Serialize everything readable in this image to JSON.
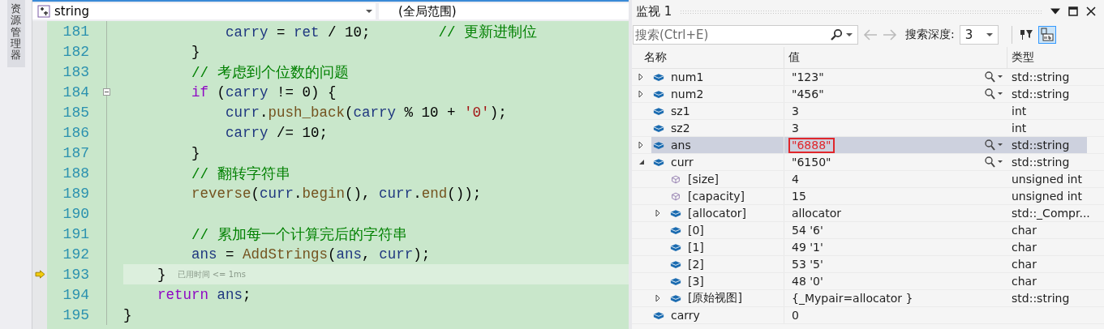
{
  "side_tab": {
    "label": "资源管理器"
  },
  "editor": {
    "scope_combo": {
      "value": "string"
    },
    "member_combo": {
      "value": "(全局范围)"
    },
    "lines": [
      {
        "number": "181",
        "current": false,
        "fold": false,
        "tokens": [
          {
            "kind": "var",
            "text": "            carry"
          },
          {
            "kind": "plain",
            "text": " = "
          },
          {
            "kind": "var",
            "text": "ret"
          },
          {
            "kind": "plain",
            "text": " / 10;        "
          },
          {
            "kind": "comment",
            "text": "// 更新进制位"
          }
        ]
      },
      {
        "number": "182",
        "current": false,
        "fold": false,
        "tokens": [
          {
            "kind": "plain",
            "text": "        }"
          }
        ]
      },
      {
        "number": "183",
        "current": false,
        "fold": false,
        "tokens": [
          {
            "kind": "comment",
            "text": "        // 考虑到个位数的问题"
          }
        ]
      },
      {
        "number": "184",
        "current": false,
        "fold": true,
        "tokens": [
          {
            "kind": "keyword",
            "text": "        if"
          },
          {
            "kind": "plain",
            "text": " ("
          },
          {
            "kind": "var",
            "text": "carry"
          },
          {
            "kind": "plain",
            "text": " != 0) {"
          }
        ]
      },
      {
        "number": "185",
        "current": false,
        "fold": false,
        "tokens": [
          {
            "kind": "var",
            "text": "            curr"
          },
          {
            "kind": "plain",
            "text": "."
          },
          {
            "kind": "func",
            "text": "push_back"
          },
          {
            "kind": "plain",
            "text": "("
          },
          {
            "kind": "var",
            "text": "carry"
          },
          {
            "kind": "plain",
            "text": " % 10 + "
          },
          {
            "kind": "string",
            "text": "'0'"
          },
          {
            "kind": "plain",
            "text": ");"
          }
        ]
      },
      {
        "number": "186",
        "current": false,
        "fold": false,
        "tokens": [
          {
            "kind": "var",
            "text": "            carry"
          },
          {
            "kind": "plain",
            "text": " /= 10;"
          }
        ]
      },
      {
        "number": "187",
        "current": false,
        "fold": false,
        "tokens": [
          {
            "kind": "plain",
            "text": "        }"
          }
        ]
      },
      {
        "number": "188",
        "current": false,
        "fold": false,
        "tokens": [
          {
            "kind": "comment",
            "text": "        // 翻转字符串"
          }
        ]
      },
      {
        "number": "189",
        "current": false,
        "fold": false,
        "tokens": [
          {
            "kind": "func",
            "text": "        reverse"
          },
          {
            "kind": "plain",
            "text": "("
          },
          {
            "kind": "var",
            "text": "curr"
          },
          {
            "kind": "plain",
            "text": "."
          },
          {
            "kind": "func",
            "text": "begin"
          },
          {
            "kind": "plain",
            "text": "(), "
          },
          {
            "kind": "var",
            "text": "curr"
          },
          {
            "kind": "plain",
            "text": "."
          },
          {
            "kind": "func",
            "text": "end"
          },
          {
            "kind": "plain",
            "text": "());"
          }
        ]
      },
      {
        "number": "190",
        "current": false,
        "fold": false
      },
      {
        "number": "191",
        "current": false,
        "fold": false,
        "tokens": [
          {
            "kind": "comment",
            "text": "        // 累加每一个计算完后的字符串"
          }
        ]
      },
      {
        "number": "192",
        "current": false,
        "fold": false,
        "tokens": [
          {
            "kind": "var",
            "text": "        ans"
          },
          {
            "kind": "plain",
            "text": " = "
          },
          {
            "kind": "func",
            "text": "AddStrings"
          },
          {
            "kind": "plain",
            "text": "("
          },
          {
            "kind": "var",
            "text": "ans"
          },
          {
            "kind": "plain",
            "text": ", "
          },
          {
            "kind": "var",
            "text": "curr"
          },
          {
            "kind": "plain",
            "text": ");"
          }
        ]
      },
      {
        "number": "193",
        "current": true,
        "fold": false,
        "hint": "已用时间 <= 1ms",
        "tokens": [
          {
            "kind": "plain",
            "text": "    }"
          }
        ]
      },
      {
        "number": "194",
        "current": false,
        "fold": false,
        "tokens": [
          {
            "kind": "keyword",
            "text": "    return"
          },
          {
            "kind": "var",
            "text": " ans"
          },
          {
            "kind": "plain",
            "text": ";"
          }
        ]
      },
      {
        "number": "195",
        "current": false,
        "fold": false,
        "tokens": [
          {
            "kind": "plain",
            "text": "}"
          }
        ]
      }
    ]
  },
  "watch": {
    "title": "监视 1",
    "search": {
      "placeholder": "搜索(Ctrl+E)"
    },
    "depth_label": "搜索深度:",
    "depth_combo": {
      "value": "3"
    },
    "hex_toggle": {
      "selected": true
    },
    "columns": [
      "名称",
      "值",
      "类型"
    ],
    "rows": [
      {
        "name": "num1",
        "value": "\"123\"",
        "type": "std::string",
        "kind": "field",
        "expandable": true,
        "expanded": false,
        "visualizer": true,
        "selected": false,
        "changed": false
      },
      {
        "name": "num2",
        "value": "\"456\"",
        "type": "std::string",
        "kind": "field",
        "expandable": true,
        "expanded": false,
        "visualizer": true,
        "selected": false,
        "changed": false
      },
      {
        "name": "sz1",
        "value": "3",
        "type": "int",
        "kind": "field",
        "expandable": false,
        "visualizer": false,
        "selected": false,
        "changed": false
      },
      {
        "name": "sz2",
        "value": "3",
        "type": "int",
        "kind": "field",
        "expandable": false,
        "visualizer": false,
        "selected": false,
        "changed": false
      },
      {
        "name": "ans",
        "value": "\"6888\"",
        "type": "std::string",
        "kind": "field",
        "expandable": true,
        "expanded": false,
        "visualizer": true,
        "selected": true,
        "changed": true
      },
      {
        "name": "curr",
        "value": "\"6150\"",
        "type": "std::string",
        "kind": "field",
        "expandable": true,
        "expanded": true,
        "visualizer": true,
        "selected": false,
        "changed": false,
        "children": [
          {
            "name": "[size]",
            "value": "4",
            "type": "unsigned int",
            "kind": "property",
            "expandable": false,
            "visualizer": false,
            "selected": false,
            "changed": false
          },
          {
            "name": "[capacity]",
            "value": "15",
            "type": "unsigned int",
            "kind": "property",
            "expandable": false,
            "visualizer": false,
            "selected": false,
            "changed": false
          },
          {
            "name": "[allocator]",
            "value": "allocator",
            "type": "std::_Compr...",
            "kind": "field",
            "expandable": true,
            "expanded": false,
            "visualizer": false,
            "selected": false,
            "changed": false
          },
          {
            "name": "[0]",
            "value": "54 '6'",
            "type": "char",
            "kind": "field",
            "expandable": false,
            "visualizer": false,
            "selected": false,
            "changed": false
          },
          {
            "name": "[1]",
            "value": "49 '1'",
            "type": "char",
            "kind": "field",
            "expandable": false,
            "visualizer": false,
            "selected": false,
            "changed": false
          },
          {
            "name": "[2]",
            "value": "53 '5'",
            "type": "char",
            "kind": "field",
            "expandable": false,
            "visualizer": false,
            "selected": false,
            "changed": false
          },
          {
            "name": "[3]",
            "value": "48 '0'",
            "type": "char",
            "kind": "field",
            "expandable": false,
            "visualizer": false,
            "selected": false,
            "changed": false
          },
          {
            "name": "[原始视图]",
            "value": "{_Mypair=allocator }",
            "type": "std::string",
            "kind": "field",
            "expandable": true,
            "expanded": false,
            "visualizer": false,
            "selected": false,
            "changed": false
          }
        ]
      },
      {
        "name": "carry",
        "value": "0",
        "kind": "field",
        "expandable": false,
        "visualizer": false,
        "selected": false,
        "changed": false
      }
    ]
  }
}
